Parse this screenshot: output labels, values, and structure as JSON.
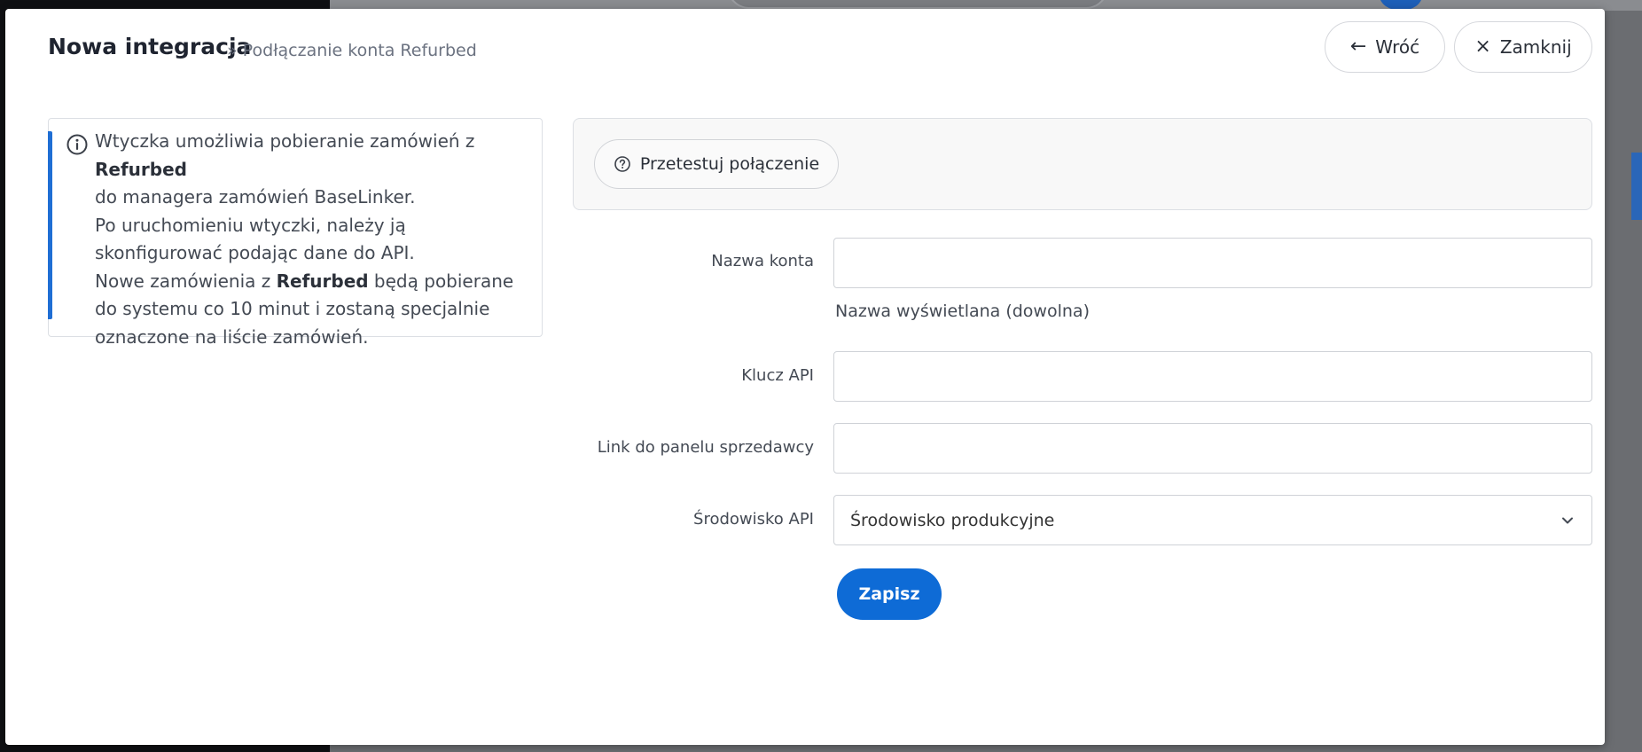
{
  "header": {
    "title": "Nowa integracja",
    "subtitle": "» Podłączanie konta Refurbed",
    "back_label": "Wróć",
    "close_label": "Zamknij"
  },
  "info": {
    "line1_pre": "Wtyczka umożliwia pobieranie zamówień z ",
    "brand": "Refurbed",
    "line2": "do managera zamówień BaseLinker.",
    "line3": "Po uruchomieniu wtyczki, należy ją skonfigurować podając dane do API.",
    "line4_pre": "Nowe zamówienia z ",
    "line4_post": " będą pobierane do systemu co 10 minut i zostaną specjalnie oznaczone na liście zamówień."
  },
  "test": {
    "label": "Przetestuj połączenie"
  },
  "form": {
    "account_name_label": "Nazwa konta",
    "account_name_value": "",
    "account_name_help": "Nazwa wyświetlana (dowolna)",
    "api_key_label": "Klucz API",
    "api_key_value": "",
    "seller_link_label": "Link do panelu sprzedawcy",
    "seller_link_value": "",
    "env_label": "Środowisko API",
    "env_selected": "Środowisko produkcyjne",
    "save_label": "Zapisz"
  },
  "colors": {
    "accent": "#1f6ed4",
    "primary_button": "#0e6bd6"
  }
}
